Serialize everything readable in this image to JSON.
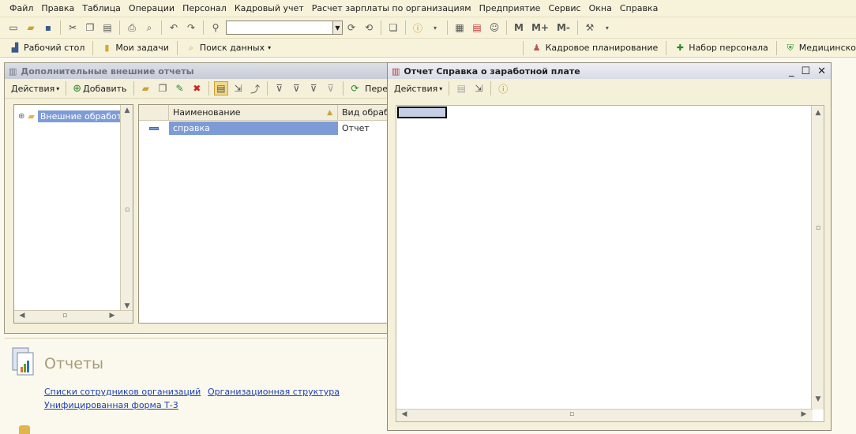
{
  "menu": [
    "Файл",
    "Правка",
    "Таблица",
    "Операции",
    "Персонал",
    "Кадровый учет",
    "Расчет зарплаты по организациям",
    "Предприятие",
    "Сервис",
    "Окна",
    "Справка"
  ],
  "toolbar1": {
    "search_value": "",
    "calc_m": "M",
    "calc_mplus": "M+",
    "calc_mminus": "M-"
  },
  "toolbar2": {
    "left": [
      "Рабочий стол",
      "Мои задачи",
      "Поиск данных"
    ],
    "right": [
      "Кадровое планирование",
      "Набор персонала",
      "Медицинско"
    ]
  },
  "ext_reports_window": {
    "title": "Дополнительные внешние отчеты",
    "actions_label": "Действия",
    "add_label": "Добавить",
    "toolbar_more": "Пере",
    "tree_root": "Внешние обработ",
    "columns": [
      "Наименование",
      "Вид обрабо"
    ],
    "rows": [
      {
        "name": "справка",
        "type": "Отчет"
      }
    ]
  },
  "report_window": {
    "title": "Отчет  Справка о заработной плате",
    "actions_label": "Действия"
  },
  "reports_panel": {
    "title": "Отчеты",
    "links": [
      "Списки сотрудников организаций",
      "Организационная структура",
      "Унифицированная форма Т-3"
    ]
  },
  "colors": {
    "selection": "#7d9bd6",
    "link": "#1d3fb3",
    "title_inactive": "#6d7280"
  }
}
